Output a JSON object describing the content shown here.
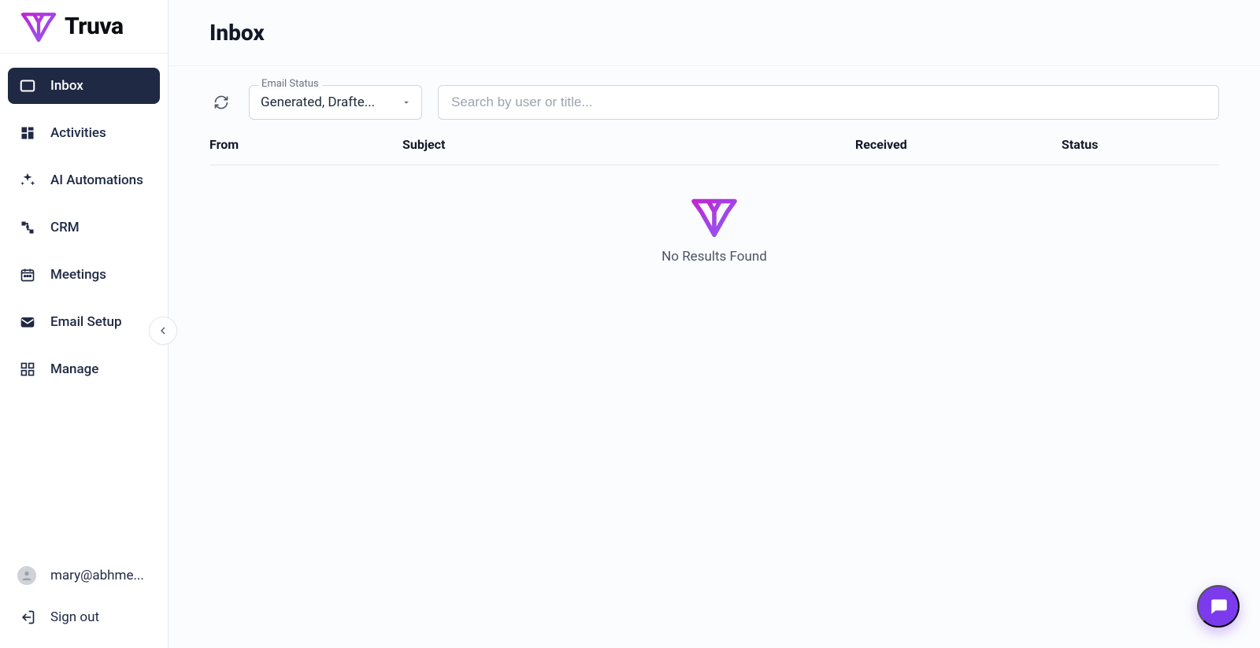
{
  "brand": {
    "name": "Truva"
  },
  "page": {
    "title": "Inbox"
  },
  "sidebar": {
    "items": [
      {
        "label": "Inbox"
      },
      {
        "label": "Activities"
      },
      {
        "label": "AI Automations"
      },
      {
        "label": "CRM"
      },
      {
        "label": "Meetings"
      },
      {
        "label": "Email Setup"
      },
      {
        "label": "Manage"
      }
    ],
    "user": "mary@abhme...",
    "signout": "Sign out"
  },
  "filters": {
    "status_label": "Email Status",
    "status_value": "Generated, Drafte...",
    "search_placeholder": "Search by user or title..."
  },
  "table": {
    "columns": [
      "From",
      "Subject",
      "Received",
      "Status"
    ]
  },
  "empty": {
    "message": "No Results Found"
  }
}
